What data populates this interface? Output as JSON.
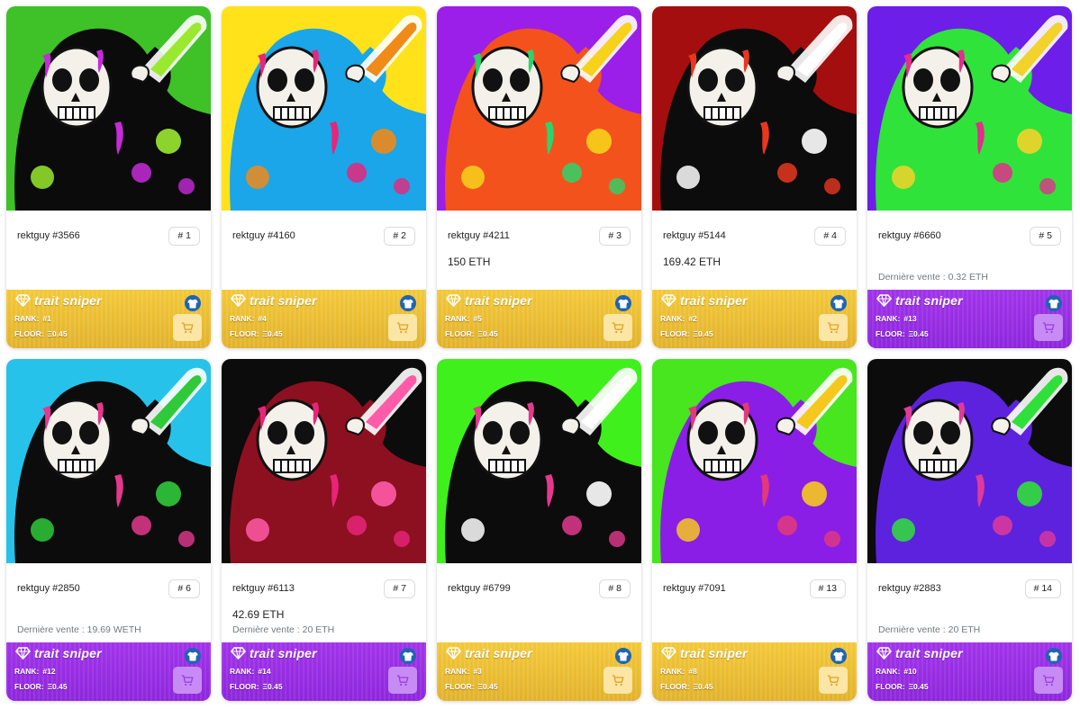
{
  "sniper_label": "trait sniper",
  "rank_label": "RANK:",
  "floor_label": "FLOOR:",
  "cards": [
    {
      "name": "rektguy #3566",
      "rank": "# 1",
      "price": "",
      "last_sale": "",
      "sniper_rank": "#1",
      "floor": "Ξ0.45",
      "theme": "gold",
      "bg": "#3fc128",
      "robe": "#0b0b0b",
      "drip": "#c52bd8",
      "accent": "#9ae92f"
    },
    {
      "name": "rektguy #4160",
      "rank": "# 2",
      "price": "",
      "last_sale": "",
      "sniper_rank": "#4",
      "floor": "Ξ0.45",
      "theme": "gold",
      "bg": "#ffe21a",
      "robe": "#1aa6e8",
      "drip": "#e8257a",
      "accent": "#f08a18"
    },
    {
      "name": "rektguy #4211",
      "rank": "# 3",
      "price": "150 ETH",
      "last_sale": "",
      "sniper_rank": "#5",
      "floor": "Ξ0.45",
      "theme": "gold",
      "bg": "#9b1fe8",
      "robe": "#f4521d",
      "drip": "#2bd56a",
      "accent": "#f6d21b"
    },
    {
      "name": "rektguy #5144",
      "rank": "# 4",
      "price": "169.42 ETH",
      "last_sale": "",
      "sniper_rank": "#2",
      "floor": "Ξ0.45",
      "theme": "gold",
      "bg": "#a40e0e",
      "robe": "#0c0c0c",
      "drip": "#e9371f",
      "accent": "#ffffff"
    },
    {
      "name": "rektguy #6660",
      "rank": "# 5",
      "price": "",
      "last_sale": "Dernière vente : 0.32 ETH",
      "sniper_rank": "#13",
      "floor": "Ξ0.45",
      "theme": "purple",
      "bg": "#6d1ee8",
      "robe": "#2fe33a",
      "drip": "#e22e8d",
      "accent": "#f2d22b"
    },
    {
      "name": "rektguy #2850",
      "rank": "# 6",
      "price": "",
      "last_sale": "Dernière vente : 19.69 WETH",
      "sniper_rank": "#12",
      "floor": "Ξ0.45",
      "theme": "purple",
      "bg": "#27c2ea",
      "robe": "#0c0c0c",
      "drip": "#e4388e",
      "accent": "#2fc93a"
    },
    {
      "name": "rektguy #6113",
      "rank": "# 7",
      "price": "42.69 ETH",
      "last_sale": "Dernière vente : 20 ETH",
      "sniper_rank": "#14",
      "floor": "Ξ0.45",
      "theme": "purple",
      "bg": "#0c0c0c",
      "robe": "#8d1020",
      "drip": "#e8247a",
      "accent": "#ff5ba8"
    },
    {
      "name": "rektguy #6799",
      "rank": "# 8",
      "price": "",
      "last_sale": "",
      "sniper_rank": "#3",
      "floor": "Ξ0.45",
      "theme": "gold",
      "bg": "#3ff01c",
      "robe": "#0c0c0c",
      "drip": "#e33a8e",
      "accent": "#ffffff"
    },
    {
      "name": "rektguy #7091",
      "rank": "# 13",
      "price": "",
      "last_sale": "",
      "sniper_rank": "#8",
      "floor": "Ξ0.45",
      "theme": "gold",
      "bg": "#47e61e",
      "robe": "#8a1ee6",
      "drip": "#e2397a",
      "accent": "#f6c81d"
    },
    {
      "name": "rektguy #2883",
      "rank": "# 14",
      "price": "",
      "last_sale": "Dernière vente : 20 ETH",
      "sniper_rank": "#10",
      "floor": "Ξ0.45",
      "theme": "purple",
      "bg": "#0c0c0c",
      "robe": "#5d22de",
      "drip": "#e03a98",
      "accent": "#2fe03a"
    }
  ]
}
